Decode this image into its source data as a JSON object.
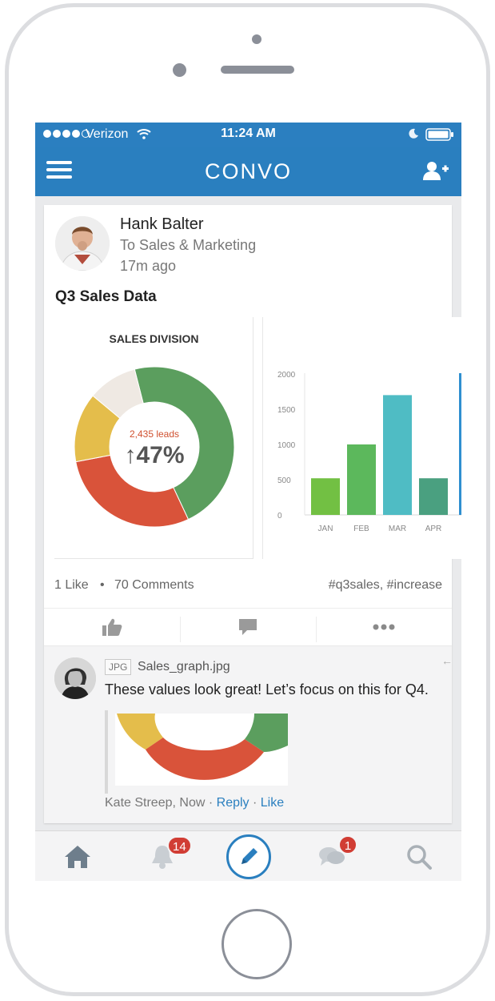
{
  "status_bar": {
    "carrier": "Verizon",
    "time": "11:24 AM"
  },
  "nav": {
    "logo": "CONVO",
    "icons": [
      "menu-icon",
      "add-user-icon"
    ]
  },
  "post": {
    "author": "Hank Balter",
    "audience": "To Sales & Marketing",
    "time_ago": "17m ago",
    "title": "Q3 Sales Data",
    "likes": "1 Like",
    "separator": "•",
    "comments": "70 Comments",
    "hashtags": "#q3sales, #increase"
  },
  "chart_data": [
    {
      "type": "pie",
      "title": "SALES DIVISION",
      "center_label": "2,435 leads",
      "center_value": "↑47%",
      "slices": [
        {
          "color": "#5b9e5e",
          "value": 47
        },
        {
          "color": "#d9533a",
          "value": 29
        },
        {
          "color": "#e4bd4b",
          "value": 14
        },
        {
          "color": "#efe9e3",
          "value": 10
        }
      ]
    },
    {
      "type": "bar",
      "categories": [
        "JAN",
        "FEB",
        "MAR",
        "APR"
      ],
      "values": [
        520,
        1000,
        1700,
        520
      ],
      "colors": [
        "#72c043",
        "#5cb85c",
        "#4fbcc4",
        "#4aa080"
      ],
      "yticks": [
        "0",
        "500",
        "1000",
        "1500",
        "2000"
      ],
      "ylim": [
        0,
        2000
      ],
      "grid": false
    }
  ],
  "actions": [
    "like-icon",
    "comment-icon",
    "more-icon"
  ],
  "comment": {
    "file_type": "JPG",
    "file_name": "Sales_graph.jpg",
    "text": "These values look great! Let’s focus on this for Q4.",
    "author_time": "Kate Streep, Now",
    "dot": "·",
    "reply": "Reply",
    "like": "Like"
  },
  "tabbar": {
    "notifications_badge": "14",
    "messages_badge": "1",
    "icons": [
      "home-icon",
      "bell-icon",
      "compose-icon",
      "chat-icon",
      "search-icon"
    ]
  }
}
